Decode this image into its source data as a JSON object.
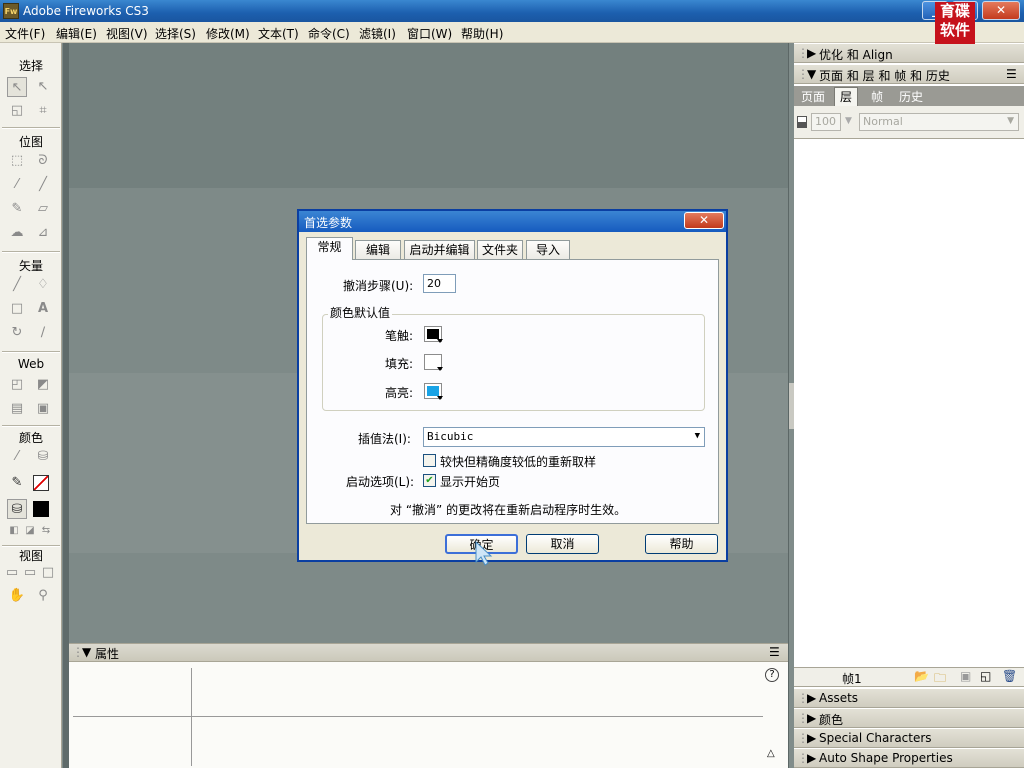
{
  "window": {
    "icon": "Fw",
    "title": "Adobe Fireworks CS3"
  },
  "logo": {
    "line1": "育碟",
    "line2": "软件"
  },
  "menu": [
    "文件(F)",
    "编辑(E)",
    "视图(V)",
    "选择(S)",
    "修改(M)",
    "文本(T)",
    "命令(C)",
    "滤镜(I)",
    "窗口(W)",
    "帮助(H)"
  ],
  "toolbox": {
    "sections": [
      "选择",
      "位图",
      "矢量",
      "Web",
      "颜色",
      "视图"
    ]
  },
  "properties": {
    "title": "属性"
  },
  "right_panel": {
    "optimize_title": "优化 和 Align",
    "pages_title": "页面 和 层 和 帧 和 历史",
    "tabs": [
      "页面",
      "层",
      "帧",
      "历史"
    ],
    "active_tab": "层",
    "opacity_value": "100",
    "blend_mode": "Normal",
    "frame_label": "帧1",
    "collapsed_panels": [
      "Assets",
      "颜色",
      "Special Characters",
      "Auto Shape Properties"
    ]
  },
  "dialog": {
    "title": "首选参数",
    "tabs": [
      "常规",
      "编辑",
      "启动并编辑",
      "文件夹",
      "导入"
    ],
    "undo_label": "撤消步骤(U):",
    "undo_value": "20",
    "color_group": "颜色默认值",
    "stroke_label": "笔触:",
    "fill_label": "填充:",
    "highlight_label": "高亮:",
    "interp_label": "插值法(I):",
    "interp_value": "Bicubic",
    "resample_label": "较快但精确度较低的重新取样",
    "startup_label": "启动选项(L):",
    "show_start_label": "显示开始页",
    "note": "对 “撤消” 的更改将在重新启动程序时生效。",
    "ok": "确定",
    "cancel": "取消",
    "help": "帮助"
  },
  "colors": {
    "stroke": "#000000",
    "fill": "#ffffff",
    "highlight": "#19a3e6",
    "titlebar": "#1c5fae"
  }
}
